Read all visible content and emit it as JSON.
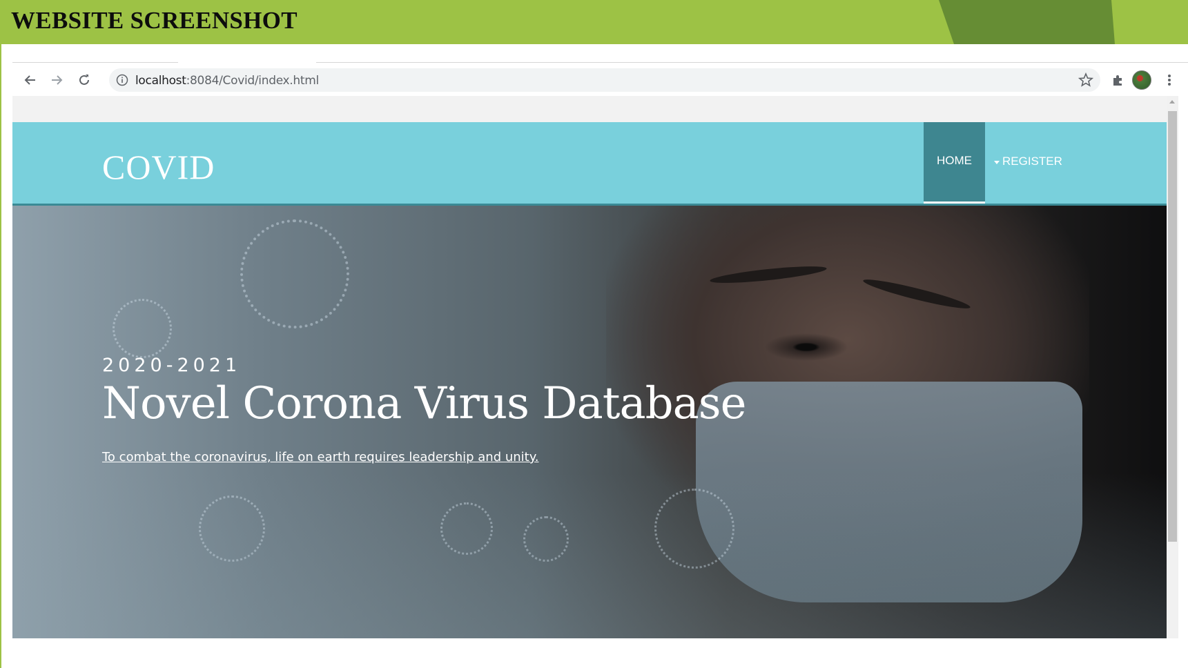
{
  "slide": {
    "title": "WEBSITE SCREENSHOT",
    "accent_color": "#9dc245",
    "dark_accent_color": "#668d34"
  },
  "browser": {
    "url_host": "localhost",
    "url_rest": ":8084/Covid/index.html",
    "icons": [
      "back-arrow-icon",
      "forward-arrow-icon",
      "reload-icon",
      "info-icon",
      "star-icon",
      "extensions-icon",
      "profile-avatar",
      "more-menu-icon"
    ]
  },
  "site": {
    "brand": "COVID",
    "nav": {
      "home": "HOME",
      "register": "REGISTER"
    },
    "navbar_color": "#79d0dc",
    "active_tab_color": "#3e8690"
  },
  "hero": {
    "kicker": "2020-2021",
    "headline": "Novel Corona Virus Database",
    "tagline": "To combat the coronavirus, life on earth requires leadership and unity."
  }
}
